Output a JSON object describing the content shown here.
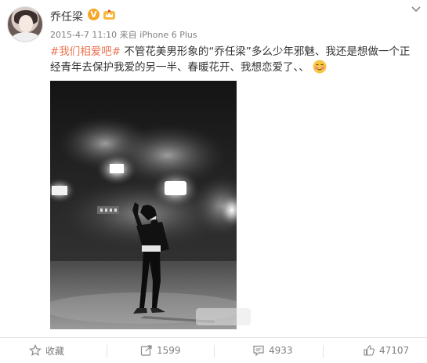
{
  "post": {
    "username": "乔任梁",
    "verified_mark": "V",
    "meta": "2015-4-7 11:10 来自 iPhone 6 Plus",
    "topic": "#我们相爱吧#",
    "text": " 不管花美男形象的“乔任梁”多么少年邪魅、我还是想做一个正经青年去保护我爱的另一半、春暖花开、我想恋爱了、、"
  },
  "actions": {
    "favorite_label": "收藏",
    "repost_count": "1599",
    "comment_count": "4933",
    "like_count": "47107"
  },
  "colors": {
    "topic": "#eb7350",
    "meta": "#808080",
    "verified": "#f5a623"
  },
  "icons": [
    "chevron-down-icon",
    "crown-icon",
    "star-icon",
    "repost-icon",
    "comment-icon",
    "like-icon",
    "blush-emoji-icon"
  ]
}
